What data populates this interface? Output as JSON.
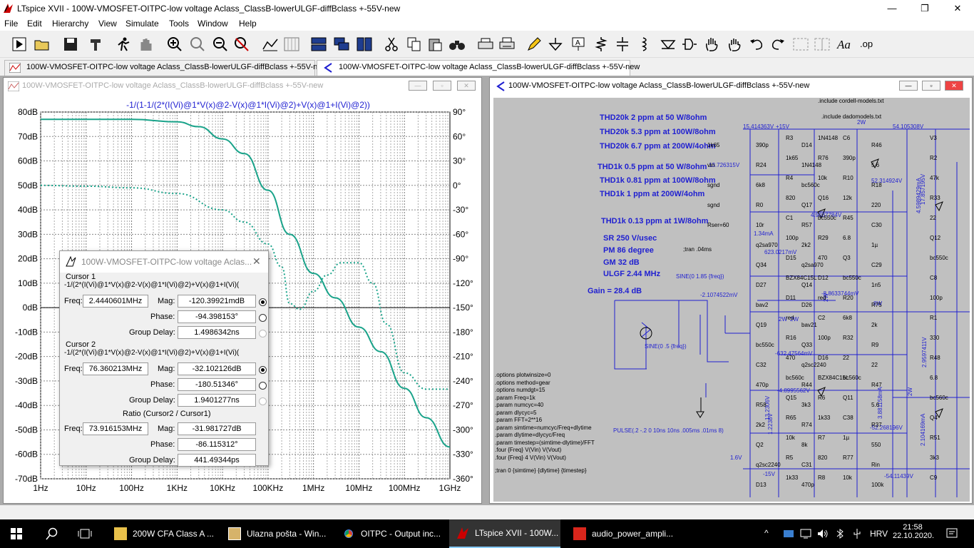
{
  "app": {
    "title": "LTspice XVII - 100W-VMOSFET-OITPC-low voltage Aclass_ClassB-lowerULGF-diffBclass +-55V-new",
    "minimize_icon": "minimize-icon",
    "maximize_icon": "restore-icon",
    "close_icon": "close-icon"
  },
  "menu": [
    "File",
    "Edit",
    "Hierarchy",
    "View",
    "Simulate",
    "Tools",
    "Window",
    "Help"
  ],
  "tabs": [
    {
      "label": "100W-VMOSFET-OITPC-low voltage Aclass_ClassB-lowerULGF-diffBclass +-55V-new",
      "icon": "waveform-icon"
    },
    {
      "label": "100W-VMOSFET-OITPC-low voltage Aclass_ClassB-lowerULGF-diffBclass +-55V-new",
      "icon": "schematic-icon"
    }
  ],
  "plot_window": {
    "title": "100W-VMOSFET-OITPC-low voltage Aclass_ClassB-lowerULGF-diffBclass +-55V-new",
    "trace_label": "-1/(1-1/(2*(I(Vi)@1*V(x)@2-V(x)@1*I(Vi)@2)+V(x)@1+I(Vi)@2))",
    "y_left_ticks": [
      "80dB",
      "70dB",
      "60dB",
      "50dB",
      "40dB",
      "30dB",
      "20dB",
      "10dB",
      "0dB",
      "-10dB",
      "-20dB",
      "-30dB",
      "-40dB",
      "-50dB",
      "-60dB",
      "-70dB"
    ],
    "y_right_ticks": [
      "90°",
      "60°",
      "30°",
      "0°",
      "-30°",
      "-60°",
      "-90°",
      "-120°",
      "-150°",
      "-180°",
      "-210°",
      "-240°",
      "-270°",
      "-300°",
      "-330°",
      "-360°"
    ],
    "x_ticks": [
      "1Hz",
      "10Hz",
      "100Hz",
      "1KHz",
      "10KHz",
      "100KHz",
      "1MHz",
      "10MHz",
      "100MHz",
      "1GHz"
    ]
  },
  "chart_data": {
    "type": "line",
    "x_scale": "log",
    "xlim": [
      1,
      1000000000
    ],
    "ylim_left": [
      -70,
      80
    ],
    "ylim_right": [
      -360,
      90
    ],
    "grid": true,
    "series": [
      {
        "name": "",
        "style": "solid",
        "axis": "left",
        "color": "#1aa38a",
        "x": [
          1,
          10,
          100,
          1000,
          3000,
          10000,
          30000,
          100000,
          300000,
          1000000,
          3000000,
          10000000,
          30000000,
          100000000,
          300000000,
          1000000000
        ],
        "y": [
          77,
          77,
          77,
          76,
          74,
          69,
          63,
          48,
          30,
          14,
          4,
          -8,
          -18,
          -33,
          -45,
          -57
        ]
      },
      {
        "name": "",
        "style": "dotted",
        "axis": "right",
        "color": "#1aa38a",
        "x": [
          1,
          10,
          100,
          1000,
          10000,
          30000,
          100000,
          200000,
          300000,
          500000,
          1000000,
          2000000,
          4000000,
          10000000,
          20000000,
          40000000,
          100000000,
          300000000,
          1000000000
        ],
        "y": [
          0,
          -1,
          -3,
          -10,
          -30,
          -45,
          -72,
          -100,
          -145,
          -152,
          -130,
          -110,
          -95,
          -95,
          -120,
          -170,
          -230,
          -250,
          -250
        ]
      }
    ]
  },
  "cursor_dialog": {
    "title": "100W-VMOSFET-OITPC-low voltage Aclas...",
    "cursor1_label": "Cursor 1",
    "cursor1_expr": "-1/(2*(I(Vi)@1*V(x)@2-V(x)@1*I(Vi)@2)+V(x)@1+I(Vi)(",
    "cursor1_freq": "2.4440601MHz",
    "cursor1_mag": "-120.39921mdB",
    "cursor1_phase": "-94.398153°",
    "cursor1_gd": "1.4986342ns",
    "cursor2_label": "Cursor 2",
    "cursor2_expr": "-1/(2*(I(Vi)@1*V(x)@2-V(x)@1*I(Vi)@2)+V(x)@1+I(Vi)(",
    "cursor2_freq": "76.360213MHz",
    "cursor2_mag": "-32.102126dB",
    "cursor2_phase": "-180.51346°",
    "cursor2_gd": "1.9401277ns",
    "ratio_label": "Ratio (Cursor2 / Cursor1)",
    "ratio_freq": "73.916153MHz",
    "ratio_mag": "-31.981727dB",
    "ratio_phase": "-86.115312°",
    "ratio_gd": "441.49344ps",
    "freq_lbl": "Freq:",
    "mag_lbl": "Mag:",
    "phase_lbl": "Phase:",
    "gd_lbl": "Group Delay:"
  },
  "schematic_window": {
    "title": "100W-VMOSFET-OITPC-low voltage Aclass_ClassB-lowerULGF-diffBclass +-55V-new",
    "notes": [
      "THD20k 2 ppm at 50 W/8ohm",
      "THD20k 5.3 ppm at 100W/8ohm",
      "THD20k 6.7 ppm at 200W/4ohm",
      "THD1k 0.5 ppm at 50 W/8ohm",
      "THD1k 0.81 ppm at 100W/8ohm",
      "THD1k 1  ppm at 200W/4ohm",
      "THD1k 0.13 ppm at 1W/8ohm",
      "SR 250 V/usec",
      "PM  86 degree",
      "GM  32 dB",
      "ULGF 2.44 MHz",
      "Gain = 28.4 dB"
    ],
    "includes": [
      ".include cordell-models.txt",
      ".include dadomodels.txt"
    ],
    "tran_cmd": ";tran .04ms",
    "directives": [
      ".options plotwinsize=0",
      ".options method=gear",
      ".options numdgt=15",
      ".param Freq=1k",
      ".param numcyc=40",
      ".param dlycyc=5",
      ".param FFT=2**16",
      ".param simtime=numcyc/Freq+dlytime",
      ".param dlytime=dlycyc/Freq",
      ".param timestep=(simtime-dlytime)/FFT",
      ".four {Freq} V(Vin) V(Vout)",
      ".four {Freq} 4 V(Vin) V(Vout)",
      ";tran 0 {simtime} {dlytime} {timestep}"
    ],
    "voltages": [
      "15.414363V",
      "+15V",
      "54.105308V",
      "13.726315V",
      "52.314924V",
      "4.9037784V",
      "1.34mA",
      "623.0217mV",
      "-2.1074522mV",
      "-8.8633744mV",
      "-632.47564mV",
      "-4.8995562V",
      "-52.268196V",
      "-54.11439V",
      "1.6V",
      "-15V",
      "2W",
      "2W",
      "8W",
      "2W",
      "2W",
      "2W",
      "17.857195V",
      "4.5989429mA",
      "2.9597411V",
      "2.104169mA",
      "3.881158mA",
      "13.2306V",
      "1.2238V"
    ],
    "parts": [
      "R3",
      "1k65",
      "R4",
      "820",
      "C1",
      "100p",
      "D15",
      "BZX84C15L",
      "D11",
      "red",
      "R16",
      "470",
      "bc560c",
      "Q15",
      "R65",
      "10k",
      "R5",
      "1k33",
      "D14",
      "1N4148",
      "bc560c",
      "Q17",
      "R57",
      "2k2",
      "q2sa970",
      "Q14",
      "D26",
      "bav21",
      "Q33",
      "q2sc2240",
      "R44",
      "3k3",
      "R74",
      "8k",
      "C31",
      "470p",
      "C6",
      "390p",
      "R10",
      "12k",
      "R45",
      "6.8",
      "Q3",
      "bc550c",
      "R20",
      "6k8",
      "R32",
      "22",
      "bc560c",
      "Q11",
      "C38",
      "1µ",
      "R77",
      "10k",
      "R46",
      "5.6",
      "R18",
      "220",
      "C30",
      "1µ",
      "C29",
      "1n5",
      "R75",
      "2k",
      "R9",
      "22",
      "R47",
      "5.6",
      "R37",
      "550",
      "Rin",
      "100k",
      "V3",
      "R2",
      "47k",
      "R33",
      "22",
      "Q12",
      "bc550c",
      "C8",
      "100p",
      "R1",
      "330",
      "R48",
      "6.8",
      "bc560c",
      "Q4",
      "R51",
      "3k3",
      "C9",
      "390p",
      "R24",
      "6k8",
      "R0",
      "10r",
      "q2sa970",
      "Q34",
      "D27",
      "bav2",
      "Q19",
      "bc550c",
      "C32",
      "470p",
      "R58",
      "2k2",
      "Q2",
      "q2sc2240",
      "D13",
      "1N4148",
      "R76",
      "10k",
      "Q16",
      "bc550c",
      "R29",
      "470",
      "D12",
      "red",
      "C2",
      "100p",
      "D16",
      "BZX84C15L",
      "R6",
      "1k33",
      "R7",
      "820",
      "R8",
      "1k65",
      "vin",
      "sgnd",
      "sgnd",
      "Rser=60"
    ],
    "sources": [
      "SINE(0 1.85 {freq})",
      "SINE(0 .5 {freq})",
      "PULSE(.2 -.2 0 10ns 10ns .005ms .01ms 8)"
    ]
  },
  "taskbar": {
    "items": [
      {
        "label": "200W CFA Class A ...",
        "icon": "folder-icon"
      },
      {
        "label": "Ulazna pošta - Win...",
        "icon": "mail-icon"
      },
      {
        "label": "OITPC - Output inc...",
        "icon": "chrome-icon"
      },
      {
        "label": "LTspice XVII - 100W...",
        "icon": "ltspice-icon"
      },
      {
        "label": "audio_power_ampli...",
        "icon": "pdf-icon"
      }
    ],
    "language": "HRV",
    "time": "21:58",
    "date": "22.10.2020."
  }
}
